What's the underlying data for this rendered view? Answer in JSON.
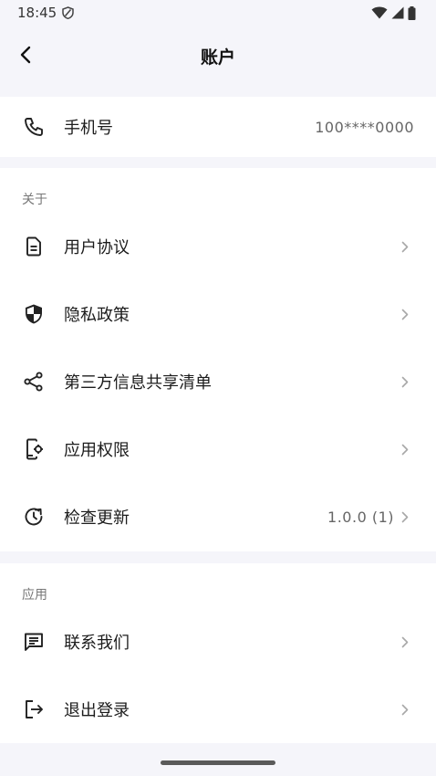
{
  "status_bar": {
    "time": "18:45"
  },
  "header": {
    "title": "账户"
  },
  "phone": {
    "label": "手机号",
    "value": "100****0000"
  },
  "about": {
    "section_label": "关于",
    "items": [
      {
        "label": "用户协议"
      },
      {
        "label": "隐私政策"
      },
      {
        "label": "第三方信息共享清单"
      },
      {
        "label": "应用权限"
      },
      {
        "label": "检查更新",
        "value": "1.0.0 (1)"
      }
    ]
  },
  "app": {
    "section_label": "应用",
    "items": [
      {
        "label": "联系我们"
      },
      {
        "label": "退出登录"
      }
    ]
  },
  "icons": {
    "back": "chevron-left-icon",
    "phone": "phone-icon",
    "agreement": "document-icon",
    "privacy": "shield-icon",
    "share": "share-icon",
    "permissions": "device-settings-icon",
    "update": "update-icon",
    "contact": "chat-icon",
    "logout": "logout-icon"
  }
}
